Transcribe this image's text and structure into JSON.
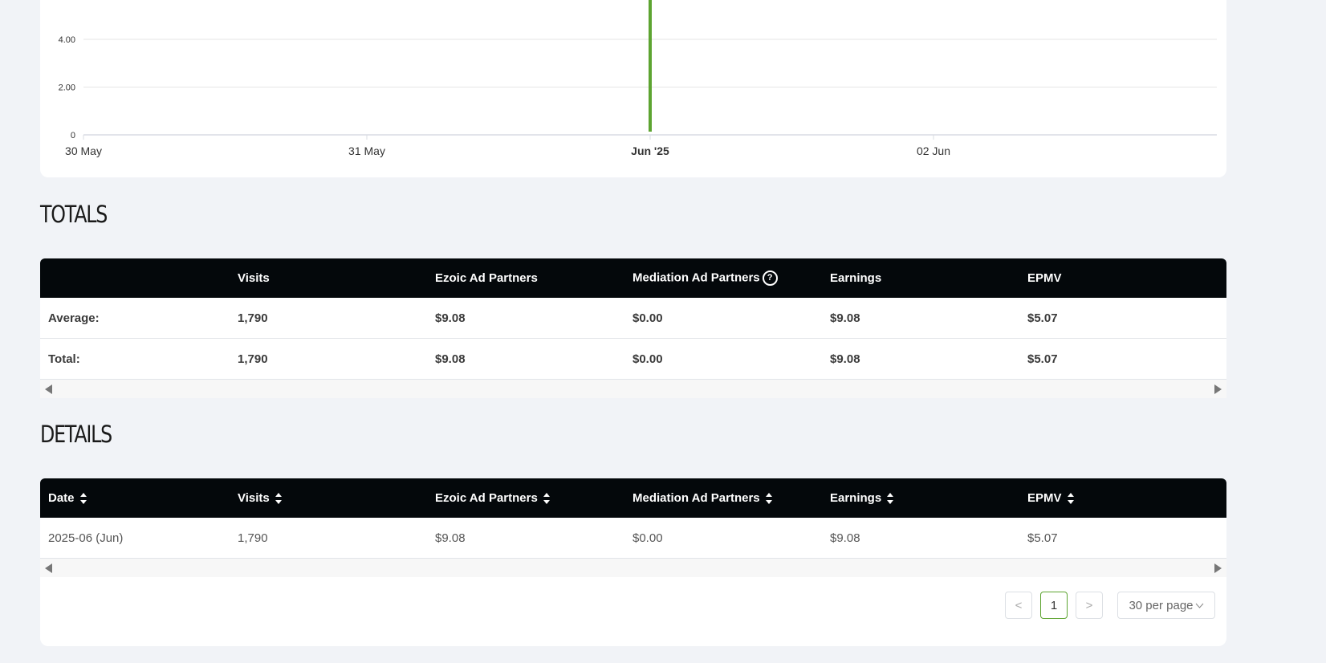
{
  "chart_data": {
    "type": "bar",
    "y_ticks": [
      "0",
      "2.00",
      "4.00"
    ],
    "x_ticks": [
      "30 May",
      "31 May",
      "Jun '25",
      "02 Jun"
    ],
    "x_tick_bold": [
      false,
      false,
      true,
      false
    ],
    "series": [
      {
        "color": "#5da431",
        "x": "Jun '25"
      }
    ],
    "grid": true
  },
  "totals": {
    "title": "TOTALS",
    "headers": [
      "",
      "Visits",
      "Ezoic Ad Partners",
      "Mediation Ad Partners",
      "Earnings",
      "EPMV"
    ],
    "rows": [
      [
        "Average:",
        "1,790",
        "$9.08",
        "$0.00",
        "$9.08",
        "$5.07"
      ],
      [
        "Total:",
        "1,790",
        "$9.08",
        "$0.00",
        "$9.08",
        "$5.07"
      ]
    ]
  },
  "details": {
    "title": "DETAILS",
    "headers": [
      "Date",
      "Visits",
      "Ezoic Ad Partners",
      "Mediation Ad Partners",
      "Earnings",
      "EPMV"
    ],
    "rows": [
      [
        "2025-06 (Jun)",
        "1,790",
        "$9.08",
        "$0.00",
        "$9.08",
        "$5.07"
      ]
    ]
  },
  "pagination": {
    "prev": "<",
    "page": "1",
    "next": ">",
    "per_page": "30 per page"
  },
  "colors": {
    "accent": "#5da431",
    "header_bg": "#04080b"
  }
}
